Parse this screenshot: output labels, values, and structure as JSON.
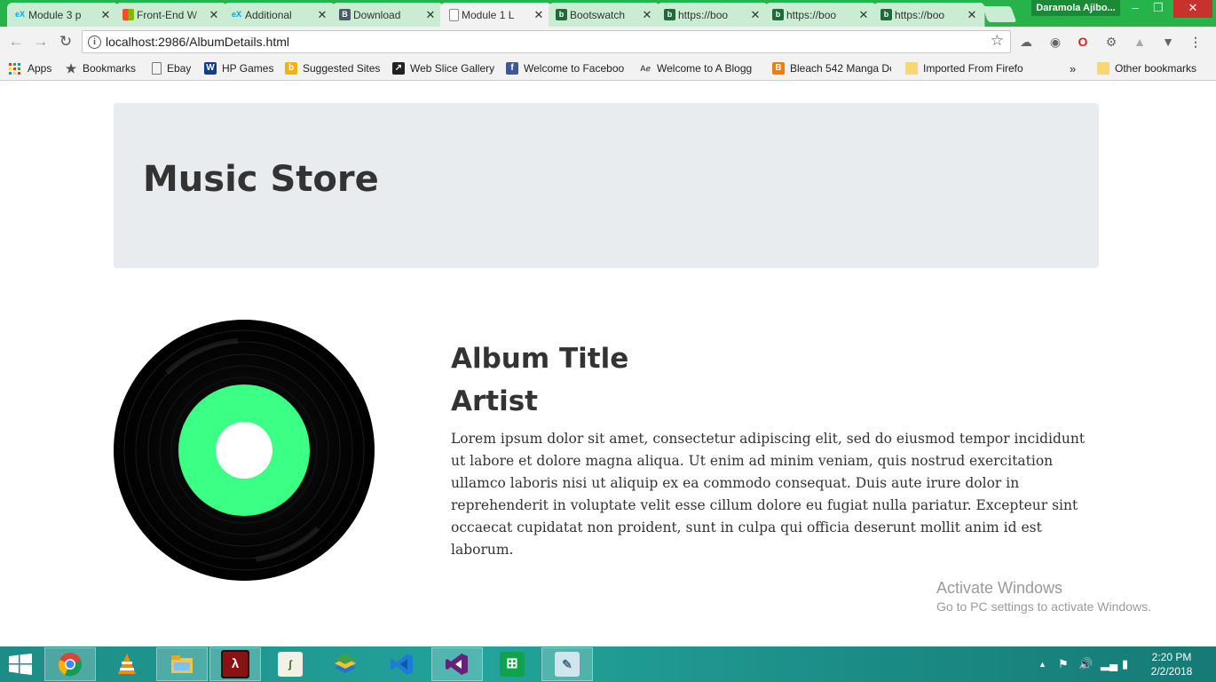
{
  "browser": {
    "tabs": [
      {
        "title": "Module 3 p",
        "icon": "edx-icon",
        "color": "#02a6e3"
      },
      {
        "title": "Front-End W",
        "icon": "microsoft-icon",
        "color": "#f25022"
      },
      {
        "title": "Additional",
        "icon": "edx-icon",
        "color": "#02a6e3"
      },
      {
        "title": "Download",
        "icon": "bootstrap-icon",
        "color": "#563d7c"
      },
      {
        "title": "Module 1 L",
        "icon": "page-icon",
        "color": "#888888",
        "active": true
      },
      {
        "title": "Bootswatch",
        "icon": "bootswatch-icon",
        "color": "#1e6a3a"
      },
      {
        "title": "https://boo",
        "icon": "bootswatch-icon",
        "color": "#1e6a3a"
      },
      {
        "title": "https://boo",
        "icon": "bootswatch-icon",
        "color": "#1e6a3a"
      },
      {
        "title": "https://boo",
        "icon": "bootswatch-icon",
        "color": "#1e6a3a"
      }
    ],
    "tab_close": "✕",
    "profile_name": "Daramola Ajibo...",
    "url": "localhost:2986/AlbumDetails.html",
    "bookmarks": [
      {
        "label": "Apps",
        "icon": "apps-grid-icon"
      },
      {
        "label": "Bookmarks",
        "icon": "star-icon"
      },
      {
        "label": "Ebay",
        "icon": "page-icon"
      },
      {
        "label": "HP Games",
        "icon": "hp-games-icon"
      },
      {
        "label": "Suggested Sites",
        "icon": "bing-icon"
      },
      {
        "label": "Web Slice Gallery",
        "icon": "web-slice-icon"
      },
      {
        "label": "Welcome to Faceboo",
        "icon": "facebook-icon"
      },
      {
        "label": "Welcome to A Blogg",
        "icon": "blog-icon"
      },
      {
        "label": "Bleach 542 Manga Do",
        "icon": "blogger-icon"
      },
      {
        "label": "Imported From Firefo",
        "icon": "folder-icon"
      }
    ],
    "bookmarks_overflow": "»",
    "other_bookmarks": "Other bookmarks"
  },
  "page": {
    "site_title": "Music Store",
    "album_title": "Album Title",
    "artist": "Artist",
    "description": "Lorem ipsum dolor sit amet, consectetur adipiscing elit, sed do eiusmod tempor incididunt ut labore et dolore magna aliqua. Ut enim ad minim veniam, quis nostrud exercitation ullamco laboris nisi ut aliquip ex ea commodo consequat. Duis aute irure dolor in reprehenderit in voluptate velit esse cillum dolore eu fugiat nulla pariatur. Excepteur sint occaecat cupidatat non proident, sunt in culpa qui officia deserunt mollit anim id est laborum.",
    "record_label_color": "#3cff86"
  },
  "watermark": {
    "line1": "Activate Windows",
    "line2": "Go to PC settings to activate Windows."
  },
  "taskbar": {
    "apps": [
      "chrome-icon",
      "vlc-icon",
      "file-explorer-icon",
      "acrobat-icon",
      "notepad-icon",
      "bluestacks-icon",
      "vscode-icon",
      "visual-studio-icon",
      "store-icon",
      "notes-icon"
    ],
    "time": "2:20 PM",
    "date": "2/2/2018"
  }
}
